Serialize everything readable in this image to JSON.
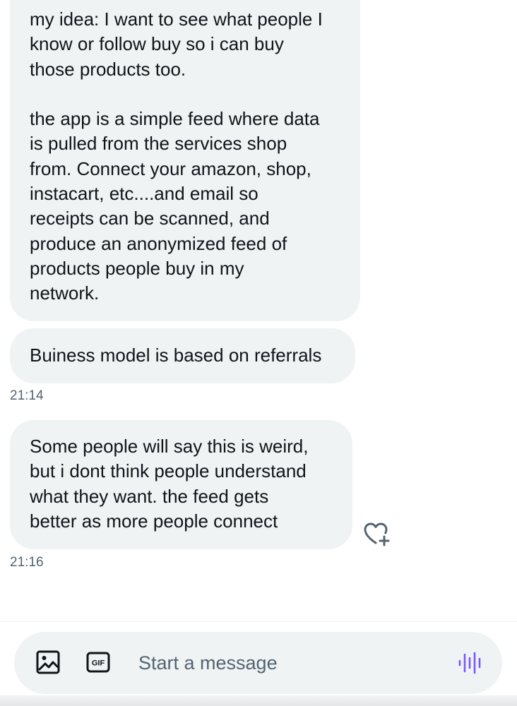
{
  "messages": [
    {
      "text": "my idea: I want to see what people I\nknow or follow buy so i can buy\nthose products too.\n\nthe app is a simple feed where data\nis pulled from the services shop\nfrom. Connect your amazon, shop,\ninstacart, etc....and email so\nreceipts can be scanned, and\nproduce an anonymized feed of\nproducts people buy in my\nnetwork."
    },
    {
      "text": "Buiness model is based on referrals",
      "time": "21:14"
    },
    {
      "text": "Some people will say this is weird,\nbut i dont think people understand\nwhat they want. the feed gets\nbetter as more people connect",
      "time": "21:16"
    }
  ],
  "composer": {
    "placeholder": "Start a message",
    "image_icon": "image-icon",
    "gif_icon": "gif-icon",
    "gif_label": "GIF",
    "voice_icon": "voice-icon"
  },
  "reaction_icon": "heart-plus-icon",
  "colors": {
    "bubble_bg": "#eff3f4",
    "text": "#0f1419",
    "muted": "#536471",
    "voice_accent": "#7856ff"
  }
}
